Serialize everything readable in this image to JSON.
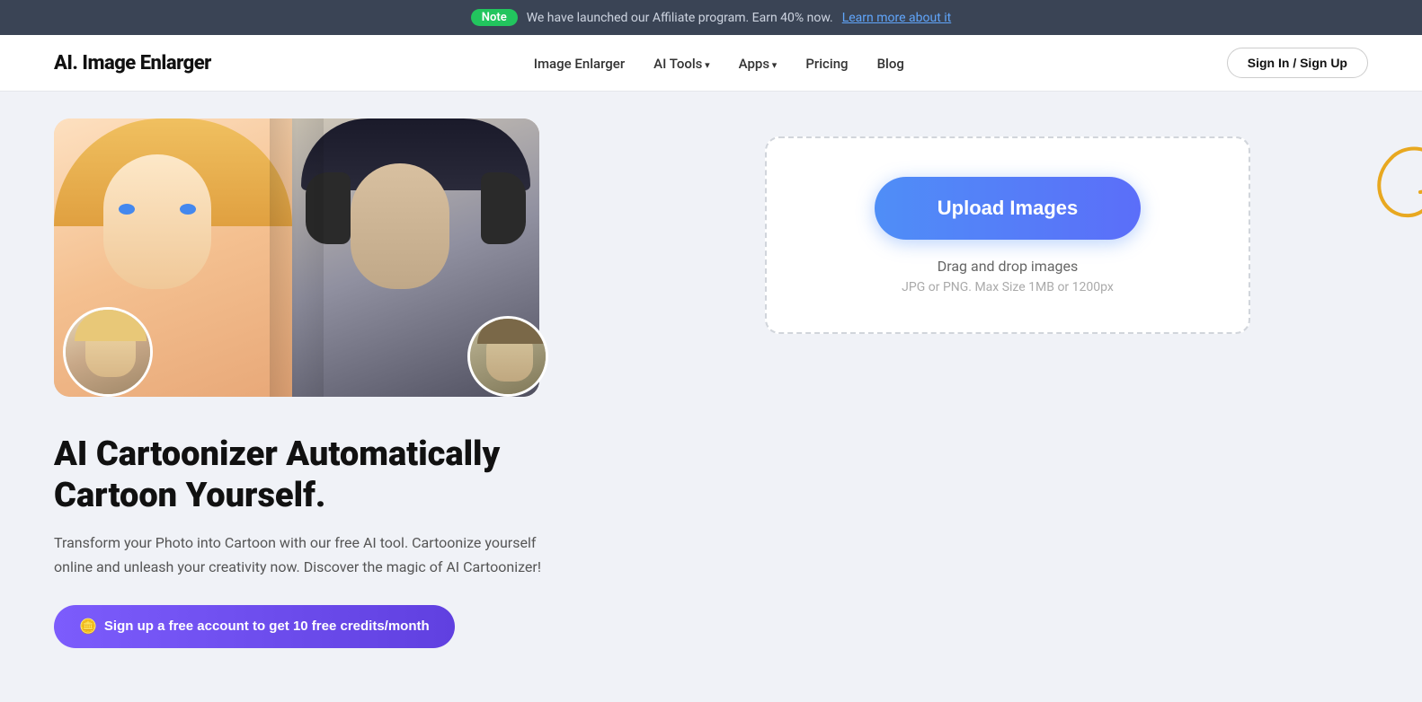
{
  "banner": {
    "note_label": "Note",
    "message": "We have launched our Affiliate program. Earn 40% now.",
    "link_text": "Learn more about it",
    "link_url": "#"
  },
  "nav": {
    "logo": "AI. Image Enlarger",
    "links": [
      {
        "id": "image-enlarger",
        "label": "Image Enlarger",
        "has_arrow": false
      },
      {
        "id": "ai-tools",
        "label": "AI Tools",
        "has_arrow": true
      },
      {
        "id": "apps",
        "label": "Apps",
        "has_arrow": true
      },
      {
        "id": "pricing",
        "label": "Pricing",
        "has_arrow": false
      },
      {
        "id": "blog",
        "label": "Blog",
        "has_arrow": false
      }
    ],
    "signin_label": "Sign In / Sign Up"
  },
  "hero": {
    "title": "AI Cartoonizer Automatically Cartoon Yourself.",
    "description": "Transform your Photo into Cartoon with our free AI tool. Cartoonize yourself online and unleash your creativity now. Discover the magic of AI Cartoonizer!",
    "cta_label": "Sign up a free account to get 10 free credits/month"
  },
  "upload": {
    "button_label": "Upload Images",
    "drag_text": "Drag and drop images",
    "file_info": "JPG or PNG. Max Size 1MB or 1200px"
  }
}
